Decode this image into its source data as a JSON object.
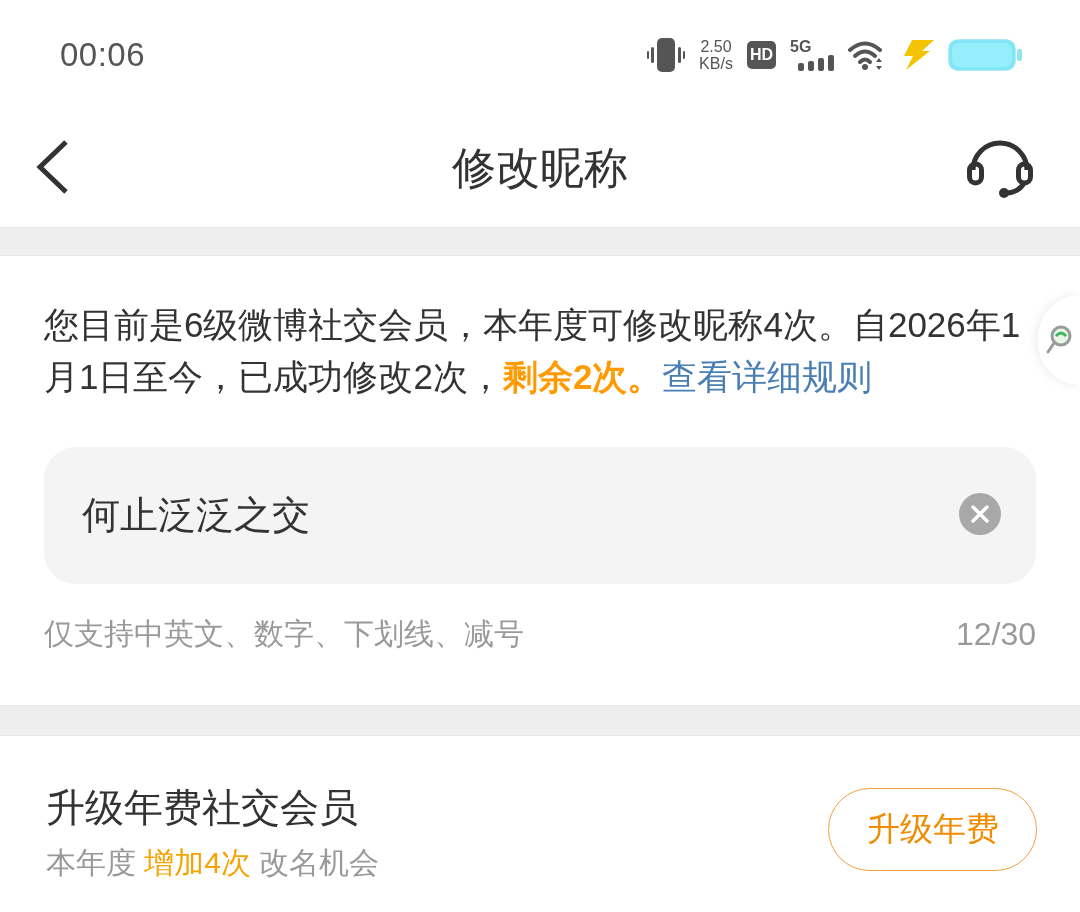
{
  "status_bar": {
    "time": "00:06",
    "net_speed": "2.50",
    "net_speed_unit": "KB/s",
    "hd_badge": "HD",
    "network_type": "5G"
  },
  "nav_bar": {
    "title": "修改昵称"
  },
  "notice": {
    "text": "您目前是6级微博社交会员，本年度可修改昵称4次。自2026年1月1日至今，已成功修改2次，**剩余2次。**",
    "link": "查看详细规则"
  },
  "nickname_field": {
    "value": "何止泛泛之交",
    "hint": "仅支持中英文、数字、下划线、减号",
    "counter": "12/30"
  },
  "upgrade": {
    "title": "升级年费社交会员",
    "subtitle": "本年度 **增加4次** 改名机会",
    "button": "升级年费"
  }
}
